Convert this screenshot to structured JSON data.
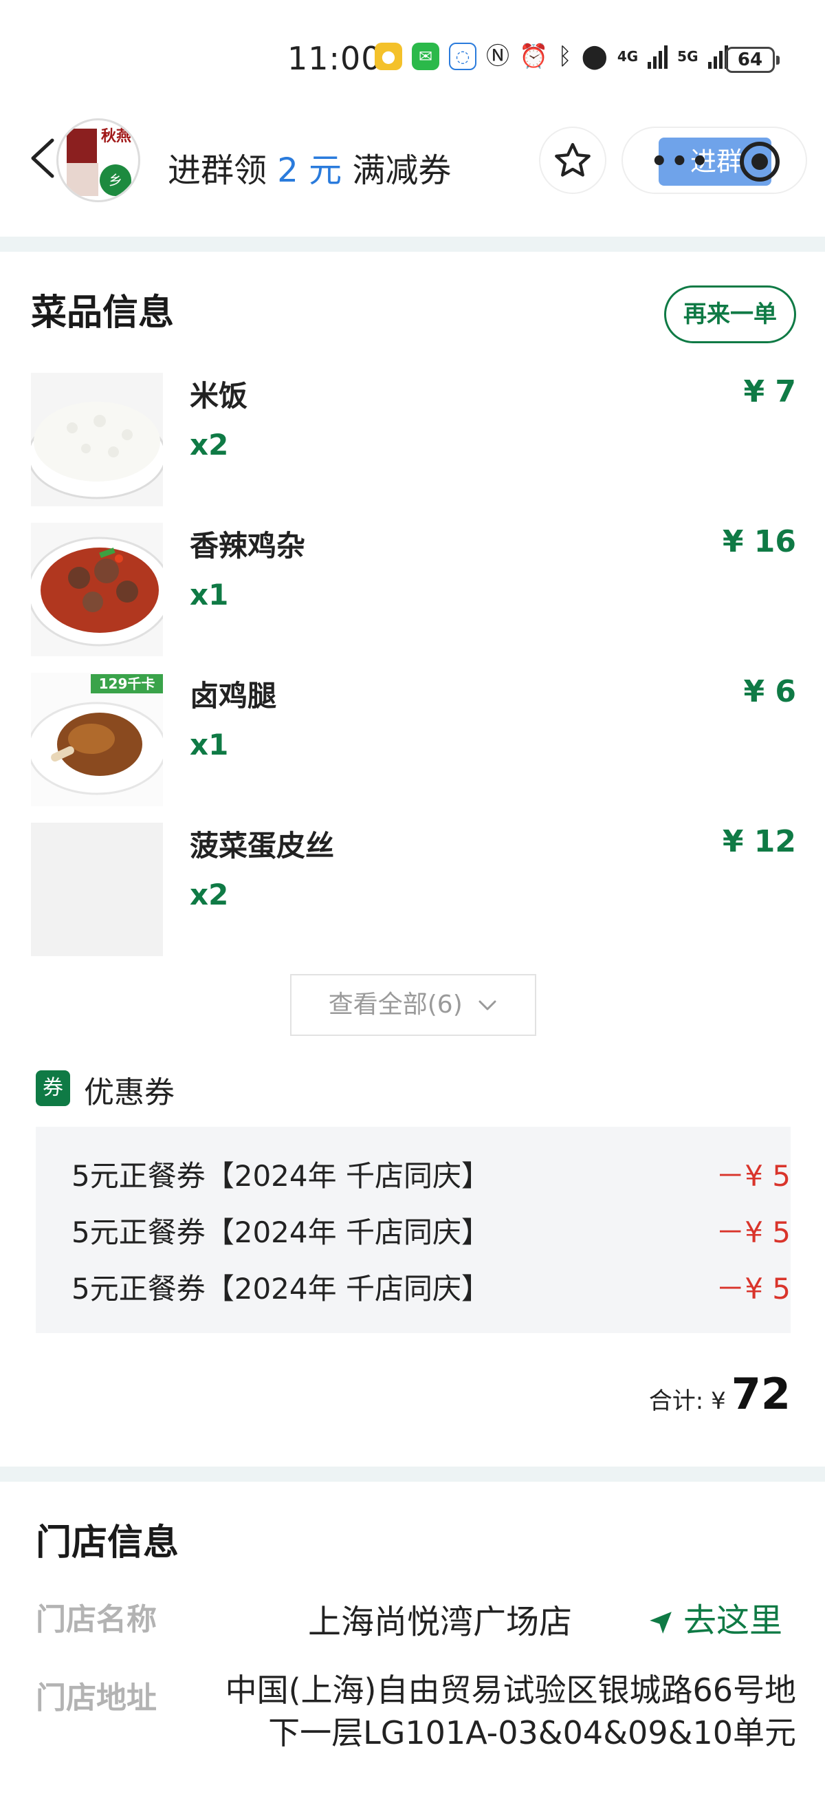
{
  "status_bar": {
    "time": "11:00",
    "network_a": "4G",
    "network_b": "5G",
    "battery": "64"
  },
  "header": {
    "title_prefix": "进群领 ",
    "title_amount": "2 元",
    "title_suffix": " 满减券",
    "join_label": "进群",
    "avatar_text_top": "秋燕",
    "avatar_text_bottom": "乡"
  },
  "dishes": {
    "section_title": "菜品信息",
    "reorder_label": "再来一单",
    "items": [
      {
        "name": "米饭",
        "qty": "x2",
        "price": "¥ 7",
        "image": "rice-bowl"
      },
      {
        "name": "香辣鸡杂",
        "qty": "x1",
        "price": "¥ 16",
        "image": "spicy-chicken-giblets"
      },
      {
        "name": "卤鸡腿",
        "qty": "x1",
        "price": "¥ 6",
        "image": "braised-drumstick",
        "badge": "129千卡"
      },
      {
        "name": "菠菜蛋皮丝",
        "qty": "x2",
        "price": "¥ 12",
        "image": "placeholder"
      }
    ],
    "view_all_label": "查看全部(6)"
  },
  "coupons": {
    "badge": "券",
    "title": "优惠券",
    "items": [
      {
        "name": "5元正餐券【2024年 千店同庆】",
        "amount": "－¥ 5"
      },
      {
        "name": "5元正餐券【2024年 千店同庆】",
        "amount": "－¥ 5"
      },
      {
        "name": "5元正餐券【2024年 千店同庆】",
        "amount": "－¥ 5"
      }
    ]
  },
  "total": {
    "label": "合计: ¥",
    "value": "72"
  },
  "store": {
    "section_title": "门店信息",
    "name_label": "门店名称",
    "name_value": "上海尚悦湾广场店",
    "navigate_label": "去这里",
    "address_label": "门店地址",
    "address_value": "中国(上海)自由贸易试验区银城路66号地下一层LG101A-03&04&09&10单元"
  },
  "colors": {
    "brand_green": "#0f7a45",
    "discount_red": "#d9342b",
    "link_blue": "#2a7bdc",
    "divider": "#edf3f4"
  }
}
